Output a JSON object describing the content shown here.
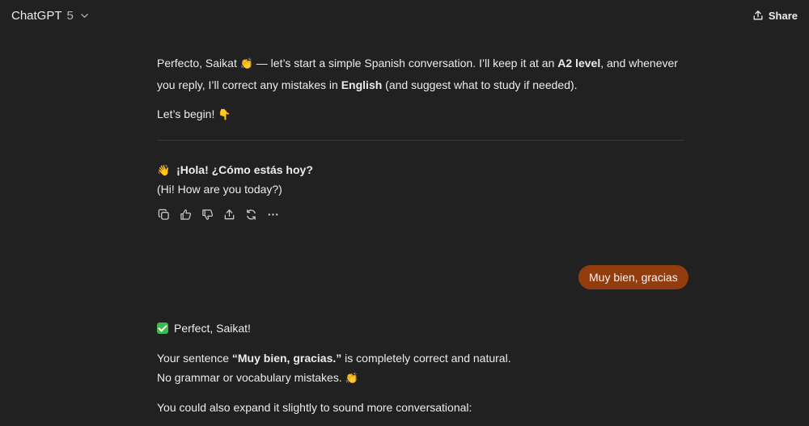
{
  "header": {
    "model_name": "ChatGPT",
    "model_version": "5",
    "share_label": "Share"
  },
  "assistant_message_1": {
    "line1_a": "Perfecto, Saikat ",
    "line1_emoji": "👏",
    "line1_b": " — let’s start a simple Spanish conversation. I’ll keep it at an ",
    "line1_bold_level": "A2 level",
    "line1_c": ", and whenever you reply, I’ll correct any mistakes in ",
    "line1_bold_lang": "English",
    "line1_d": " (and suggest what to study if needed).",
    "begin_text": "Let’s begin! ",
    "begin_emoji": "👇",
    "question_emoji": "👋",
    "question_es": "¡Hola! ¿Cómo estás hoy?",
    "question_en": "(Hi! How are you today?)"
  },
  "action_icons": [
    "copy-icon",
    "thumbs-up-icon",
    "thumbs-down-icon",
    "share-icon",
    "regenerate-icon",
    "more-icon"
  ],
  "user_message": {
    "text": "Muy bien, gracias"
  },
  "assistant_message_2": {
    "heading": "Perfect, Saikat!",
    "sentence_a": "Your sentence ",
    "sentence_bold": "“Muy bien, gracias.”",
    "sentence_b": " is completely correct and natural.",
    "no_mistakes": "No grammar or vocabulary mistakes. ",
    "no_mistakes_emoji": "👏",
    "expand_text": "You could also expand it slightly to sound more conversational:"
  },
  "colors": {
    "background": "#212121",
    "user_bubble": "#933d0f",
    "check": "#3fb950"
  }
}
